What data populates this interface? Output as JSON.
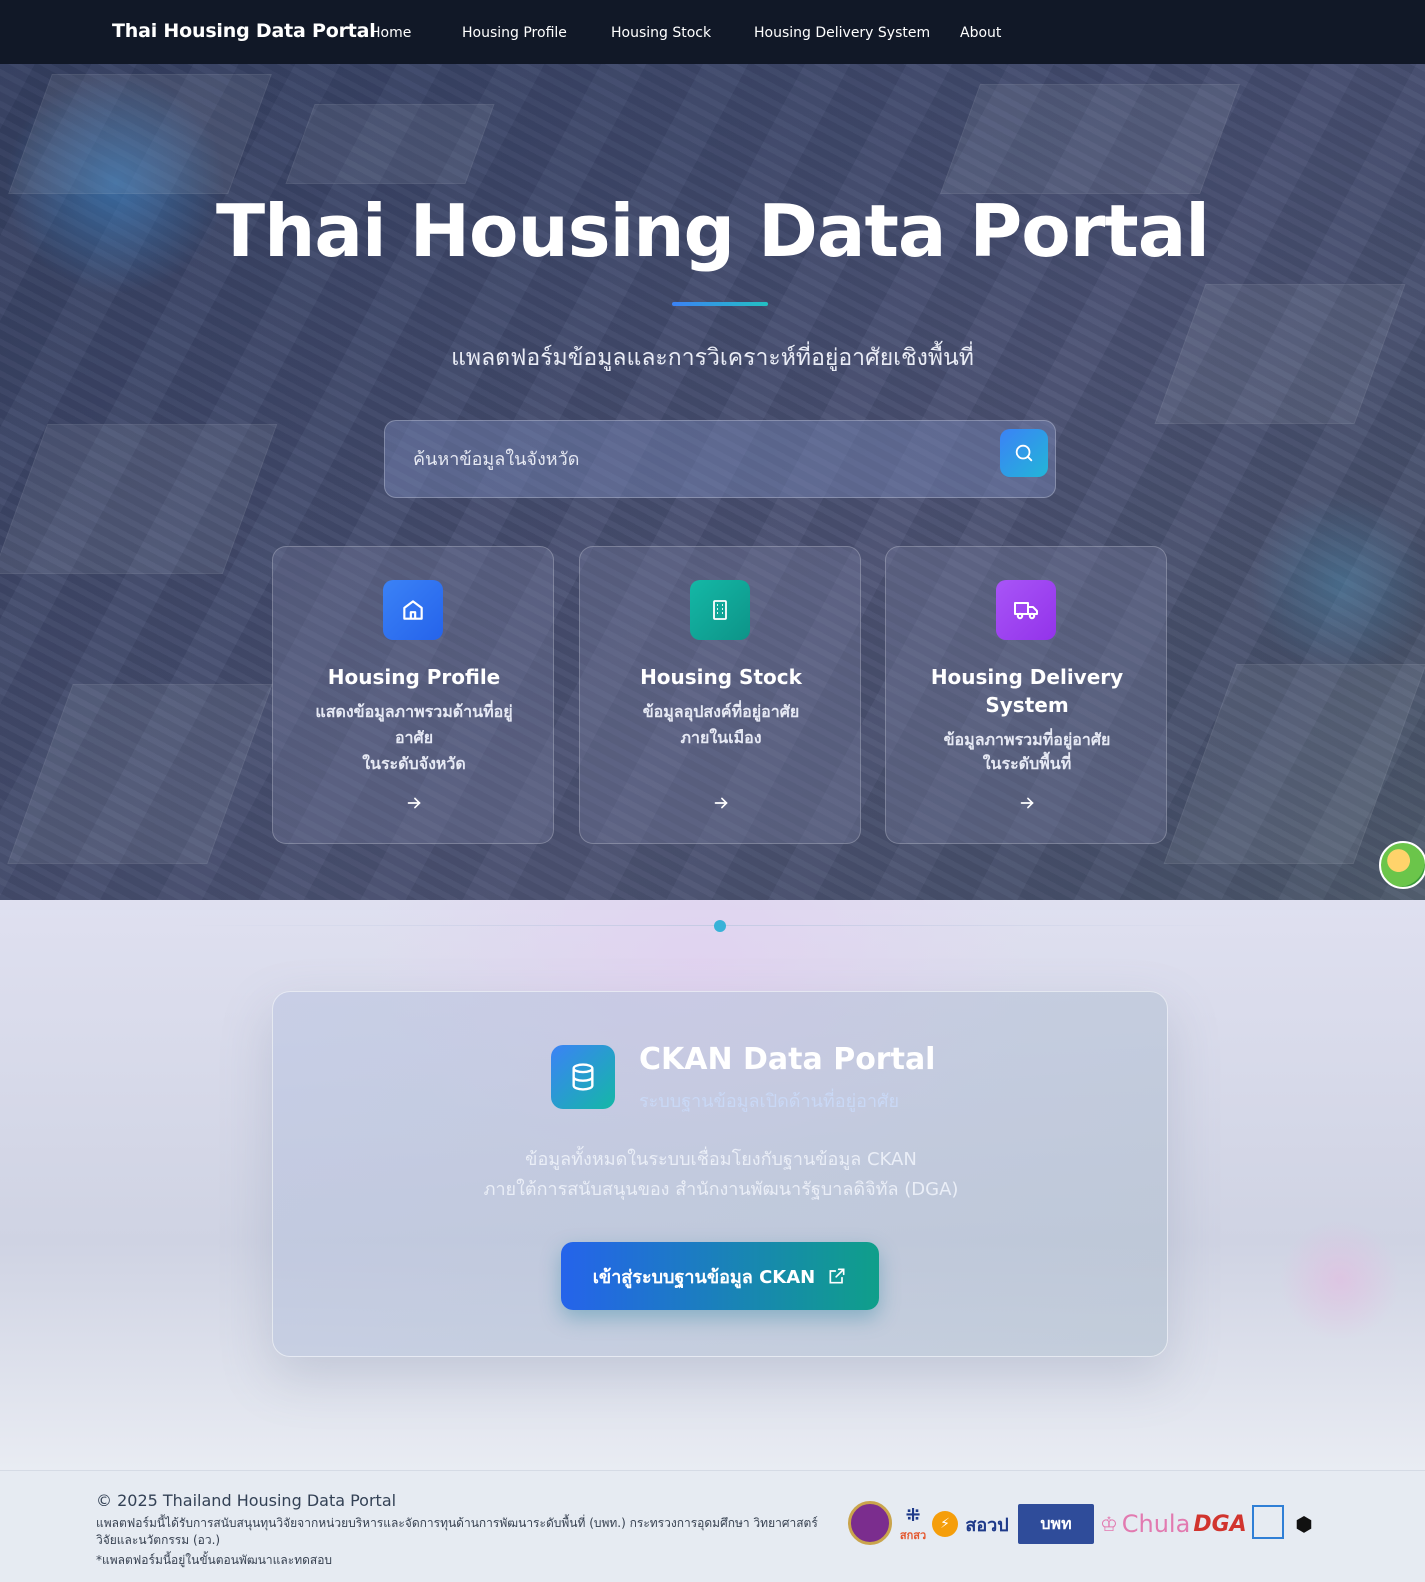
{
  "nav": {
    "brand": "Thai Housing Data Portal",
    "links": [
      "Home",
      "Housing Profile",
      "Housing Stock",
      "Housing Delivery System",
      "About"
    ]
  },
  "hero": {
    "title": "Thai Housing Data Portal",
    "subtitle": "แพลตฟอร์มข้อมูลและการวิเคราะห์ที่อยู่อาศัยเชิงพื้นที่",
    "search_placeholder": "ค้นหาข้อมูลในจังหวัด",
    "cards": [
      {
        "icon": "home-icon",
        "color": "#3b82f6",
        "title": "Housing Profile",
        "desc": [
          "แสดงข้อมูลภาพรวมด้านที่อยู่",
          "อาศัย",
          "ในระดับจังหวัด"
        ]
      },
      {
        "icon": "building-icon",
        "color": "#14b8a6",
        "title": "Housing Stock",
        "desc": [
          "ข้อมูลอุปสงค์ที่อยู่อาศัย",
          "ภายในเมือง"
        ]
      },
      {
        "icon": "truck-icon",
        "color": "#a855f7",
        "title_lines": [
          "Housing Delivery",
          "System"
        ],
        "desc": [
          "ข้อมูลภาพรวมที่อยู่อาศัย",
          "ในระดับพื้นที่"
        ]
      }
    ]
  },
  "ckan": {
    "title": "CKAN Data Portal",
    "subtitle": "ระบบฐานข้อมูลเปิดด้านที่อยู่อาศัย",
    "desc_line1": "ข้อมูลทั้งหมดในระบบเชื่อมโยงกับฐานข้อมูล CKAN",
    "desc_line2": "ภายใต้การสนับสนุนของ สำนักงานพัฒนารัฐบาลดิจิทัล (DGA)",
    "button_label": "เข้าสู่ระบบฐานข้อมูล CKAN"
  },
  "footer": {
    "copyright": "© 2025 Thailand Housing Data Portal",
    "note": "แพลตฟอร์มนี้ได้รับการสนับสนุนทุนวิจัยจากหน่วยบริหารและจัดการทุนด้านการพัฒนาระดับพื้นที่ (บพท.) กระทรวงการอุดมศึกษา วิทยาศาสตร์ วิจัยและนวัตกรรม (อว.)",
    "note2": "*แพลตฟอร์มนี้อยู่ในขั้นตอนพัฒนาและทดสอบ",
    "logos": {
      "seal": "",
      "sksw": "สกสว",
      "sorpor": "สอวป",
      "bpt": "บพท",
      "chula": "Chula",
      "dga": "DGA"
    }
  },
  "colors": {
    "nav_bg": "#111827",
    "accent_blue": "#3b82f6",
    "accent_teal": "#14b8a6",
    "accent_purple": "#a855f7"
  }
}
